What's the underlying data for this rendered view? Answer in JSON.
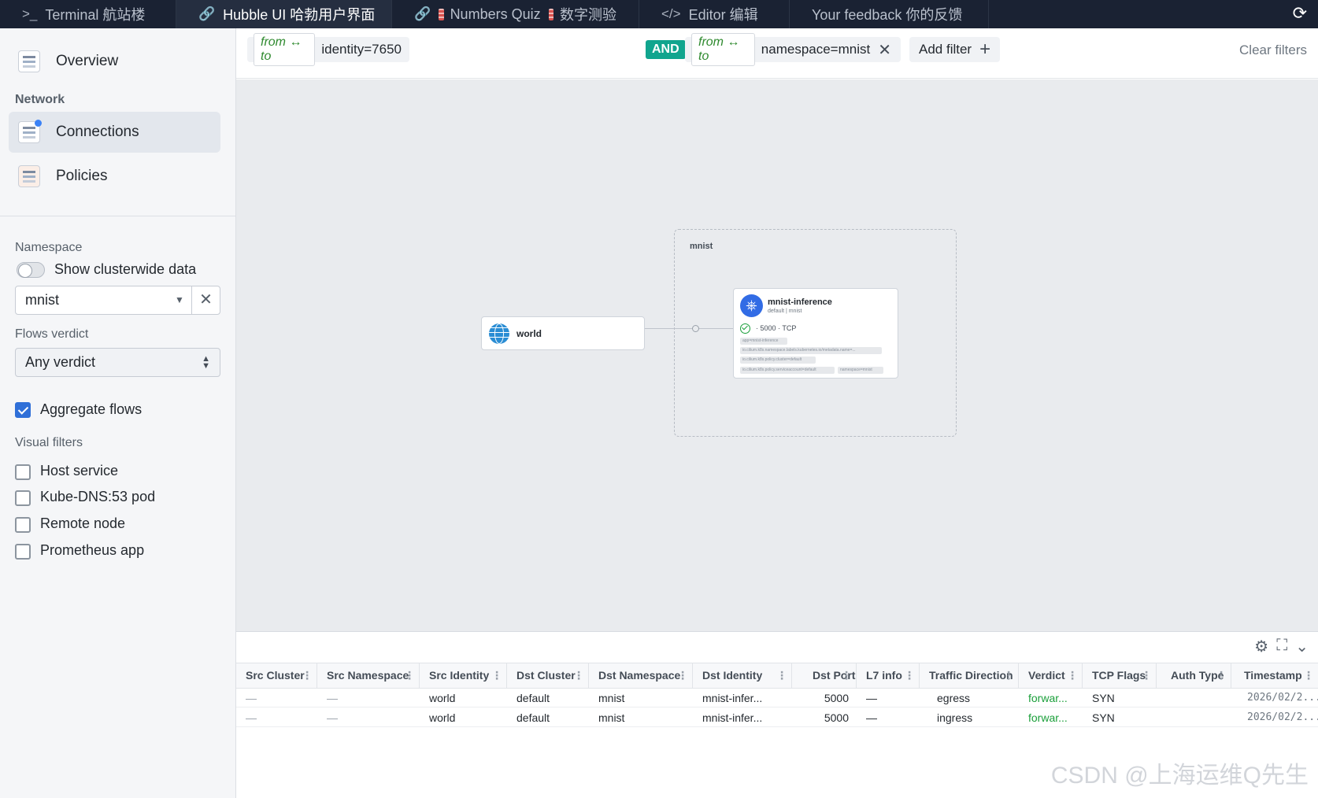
{
  "tabs": [
    {
      "icon": "terminal-icon",
      "label": "Terminal 航站楼"
    },
    {
      "icon": "link-icon",
      "label": "Hubble UI 哈勃用户界面"
    },
    {
      "icon": "link-icon",
      "label_a": "Numbers Quiz",
      "label_b": "数字测验"
    },
    {
      "icon": "code-icon",
      "label": "Editor 编辑"
    },
    {
      "label": "Your feedback 你的反馈"
    }
  ],
  "sidebar": {
    "nav": [
      {
        "label": "Overview",
        "icon": "overview-icon"
      },
      {
        "label": "Connections",
        "icon": "connections-icon"
      },
      {
        "label": "Policies",
        "icon": "policies-icon"
      }
    ],
    "network_title": "Network",
    "namespace_label": "Namespace",
    "clusterwide_label": "Show clusterwide data",
    "namespace_value": "mnist",
    "verdict_label": "Flows verdict",
    "verdict_value": "Any verdict",
    "aggregate_label": "Aggregate flows",
    "visual_filters_title": "Visual filters",
    "visual_filters": [
      "Host service",
      "Kube-DNS:53 pod",
      "Remote node",
      "Prometheus app"
    ]
  },
  "filters": {
    "chip1_dir": "from ↔ to",
    "chip1_value": "identity=7650",
    "and_label": "AND",
    "chip2_dir": "from ↔ to",
    "chip2_value": "namespace=mnist",
    "add_filter": "Add filter",
    "clear_filters": "Clear filters"
  },
  "map": {
    "namespace": "mnist",
    "world_label": "world",
    "service": {
      "name": "mnist-inference",
      "sub": "default | mnist",
      "port": "· 5000 · TCP",
      "labels": [
        "app=mnist-inference",
        "io.cilium.k8s.namespace.labels.kubernetes.io/metadata.name=...",
        "io.cilium.k8s.policy.cluster=default",
        "io.cilium.k8s.policy.serviceaccount=default",
        "namespace=mnist"
      ]
    }
  },
  "table": {
    "headers": [
      "Src Cluster",
      "Src Namespace",
      "Src Identity",
      "Dst Cluster",
      "Dst Namespace",
      "Dst Identity",
      "Dst Port",
      "L7 info",
      "Traffic Direction",
      "Verdict",
      "TCP Flags",
      "Auth Type",
      "Timestamp"
    ],
    "rows": [
      [
        "—",
        "—",
        "world",
        "default",
        "mnist",
        "mnist-infer...",
        "5000",
        "—",
        "egress",
        "forwar...",
        "SYN",
        "",
        "2026/02/2..."
      ],
      [
        "—",
        "—",
        "world",
        "default",
        "mnist",
        "mnist-infer...",
        "5000",
        "—",
        "ingress",
        "forwar...",
        "SYN",
        "",
        "2026/02/2..."
      ]
    ]
  },
  "watermark": "CSDN @上海运维Q先生",
  "colors": {
    "accent": "#2f6fd8",
    "and_badge": "#11a58e",
    "forwarded": "#1a9f3a",
    "tabbar": "#1a2233"
  }
}
